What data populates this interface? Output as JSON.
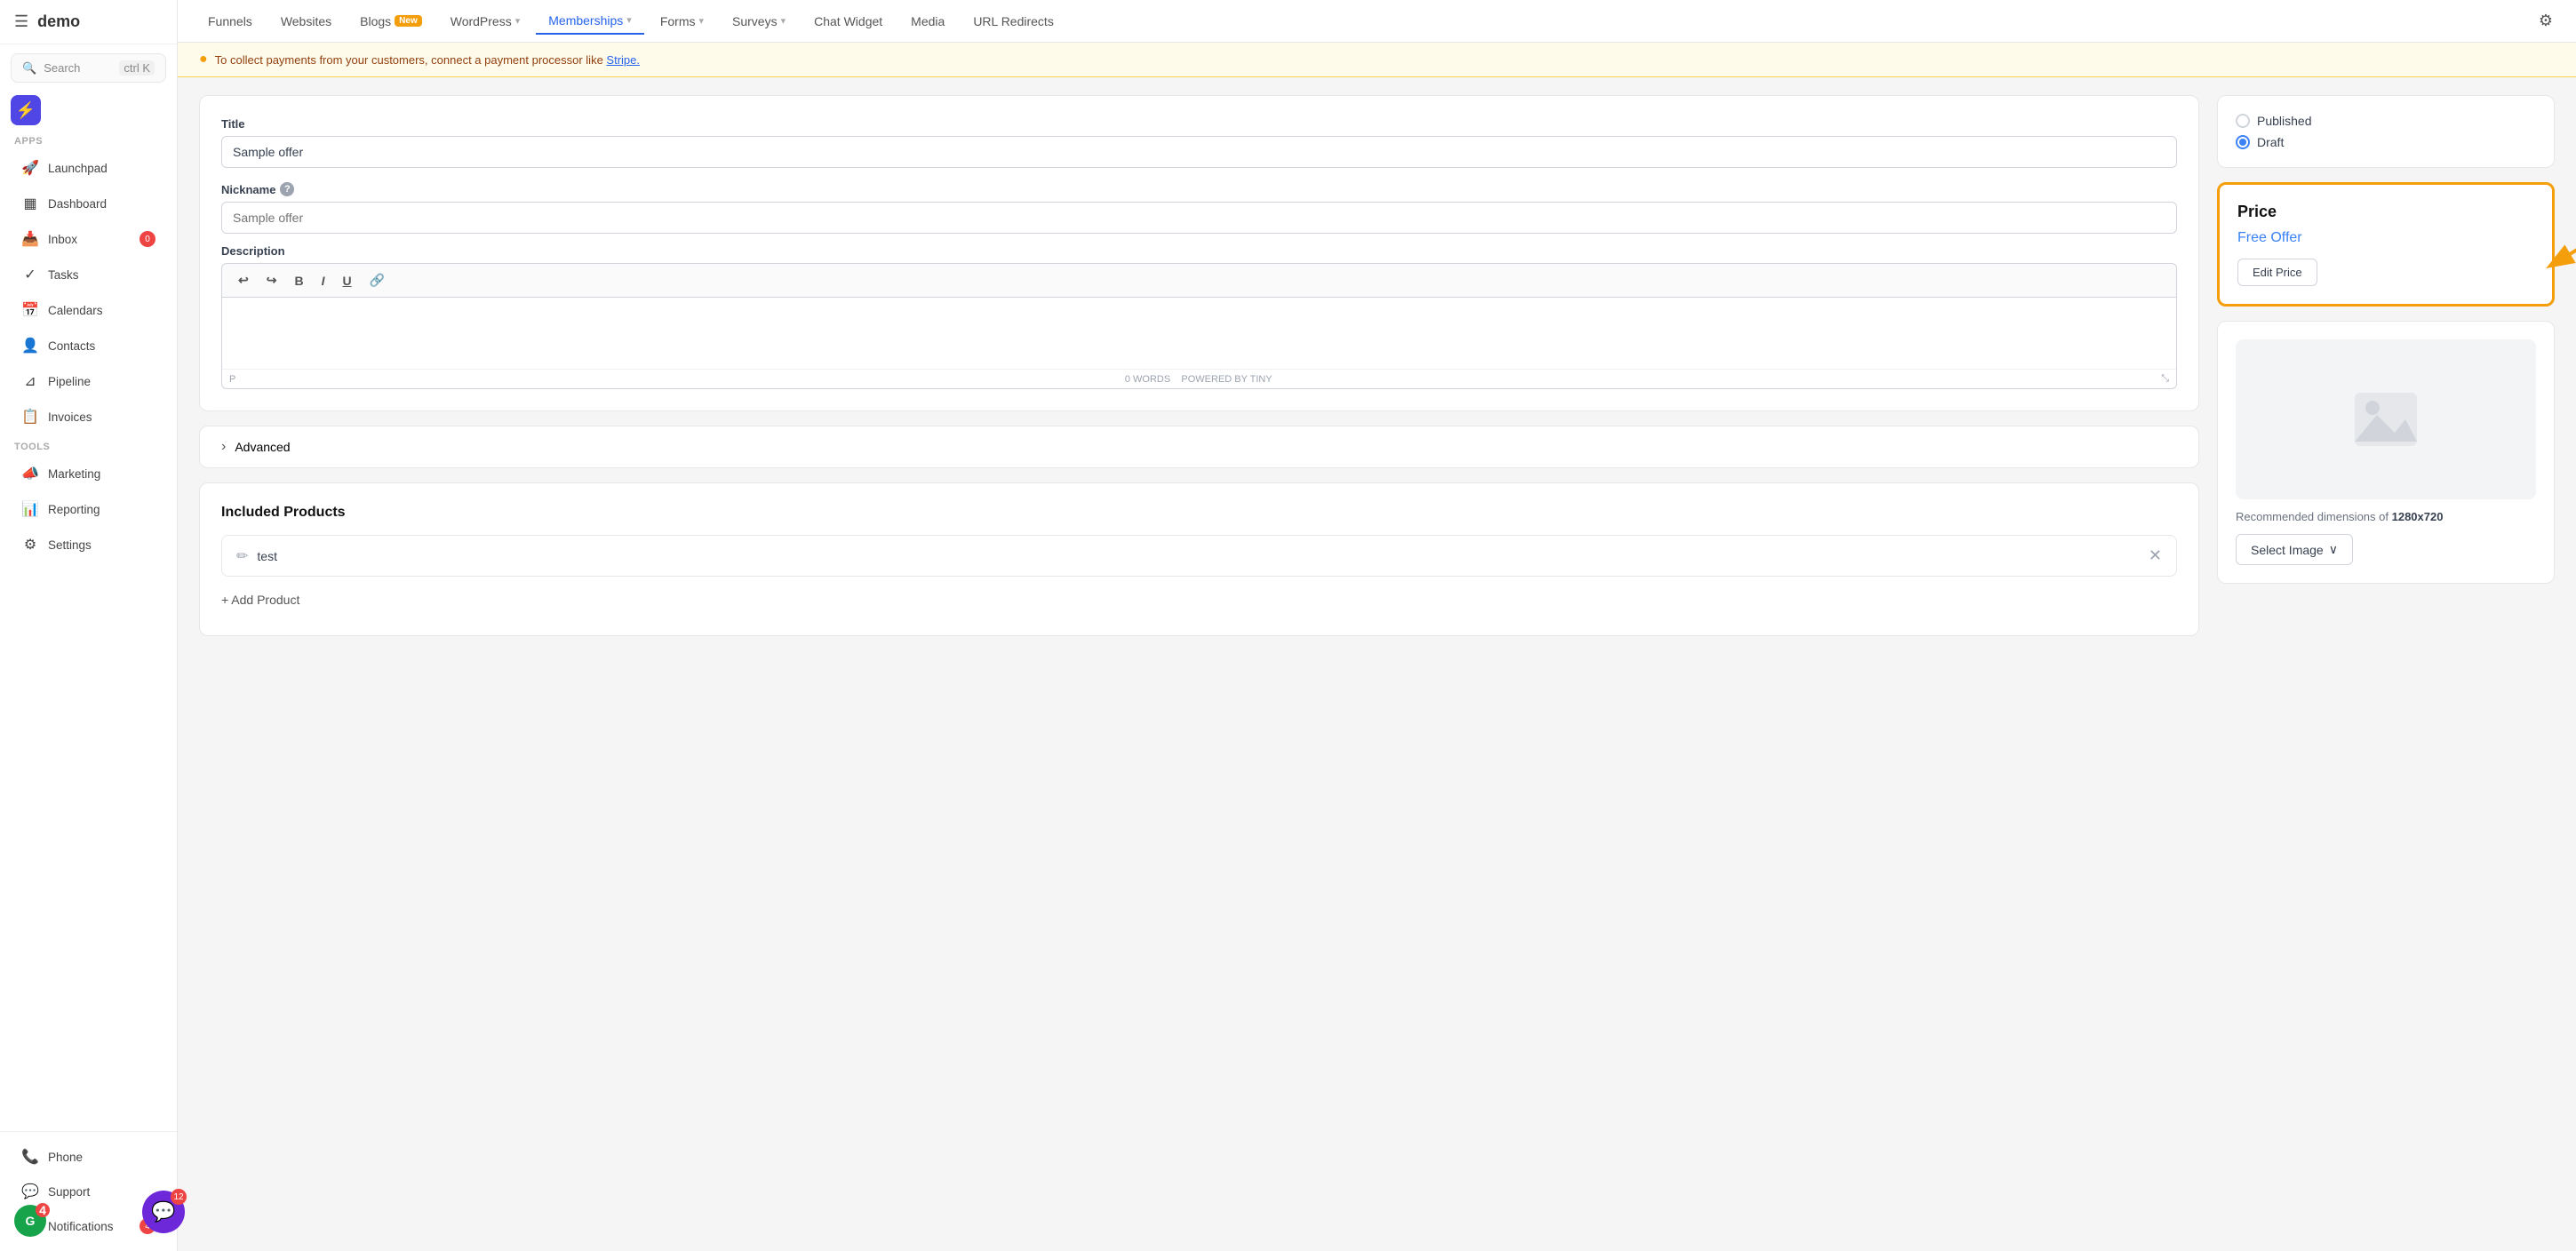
{
  "app": {
    "logo": "demo",
    "search_label": "Search",
    "search_shortcut": "ctrl K"
  },
  "sidebar": {
    "apps_label": "Apps",
    "tools_label": "Tools",
    "items": [
      {
        "id": "launchpad",
        "label": "Launchpad",
        "icon": "🚀",
        "badge": null
      },
      {
        "id": "dashboard",
        "label": "Dashboard",
        "icon": "▦",
        "badge": null
      },
      {
        "id": "inbox",
        "label": "Inbox",
        "icon": "📥",
        "badge": "0"
      },
      {
        "id": "tasks",
        "label": "Tasks",
        "icon": "✓",
        "badge": null
      },
      {
        "id": "calendars",
        "label": "Calendars",
        "icon": "📅",
        "badge": null
      },
      {
        "id": "contacts",
        "label": "Contacts",
        "icon": "👤",
        "badge": null
      },
      {
        "id": "pipeline",
        "label": "Pipeline",
        "icon": "⊿",
        "badge": null
      },
      {
        "id": "invoices",
        "label": "Invoices",
        "icon": "📋",
        "badge": null
      },
      {
        "id": "marketing",
        "label": "Marketing",
        "icon": "📣",
        "badge": null
      },
      {
        "id": "reporting",
        "label": "Reporting",
        "icon": "📊",
        "badge": null
      },
      {
        "id": "settings",
        "label": "Settings",
        "icon": "⚙",
        "badge": null
      }
    ],
    "bottom_items": [
      {
        "id": "phone",
        "label": "Phone",
        "icon": "📞"
      },
      {
        "id": "support",
        "label": "Support",
        "icon": "💬"
      },
      {
        "id": "notifications",
        "label": "Notifications",
        "icon": "🔔",
        "badge": "4"
      }
    ]
  },
  "top_nav": {
    "items": [
      {
        "id": "funnels",
        "label": "Funnels",
        "has_chevron": false,
        "new": false
      },
      {
        "id": "websites",
        "label": "Websites",
        "has_chevron": false,
        "new": false
      },
      {
        "id": "blogs",
        "label": "Blogs",
        "has_chevron": false,
        "new": true
      },
      {
        "id": "wordpress",
        "label": "WordPress",
        "has_chevron": true,
        "new": false
      },
      {
        "id": "memberships",
        "label": "Memberships",
        "has_chevron": true,
        "new": false,
        "active": true
      },
      {
        "id": "forms",
        "label": "Forms",
        "has_chevron": true,
        "new": false
      },
      {
        "id": "surveys",
        "label": "Surveys",
        "has_chevron": true,
        "new": false
      },
      {
        "id": "chat-widget",
        "label": "Chat Widget",
        "has_chevron": false,
        "new": false
      },
      {
        "id": "media",
        "label": "Media",
        "has_chevron": false,
        "new": false
      },
      {
        "id": "url-redirects",
        "label": "URL Redirects",
        "has_chevron": false,
        "new": false
      }
    ],
    "gear_icon_label": "settings"
  },
  "warning_banner": {
    "message": "To collect payments from your customers, connect a payment processor like Stripe.",
    "link_text": "Stripe."
  },
  "form": {
    "title_label": "Title",
    "title_value": "Sample offer",
    "nickname_label": "Nickname",
    "nickname_placeholder": "Sample offer",
    "description_label": "Description",
    "editor_undo": "↩",
    "editor_redo": "↪",
    "editor_bold": "B",
    "editor_italic": "I",
    "editor_underline": "U",
    "editor_link": "🔗",
    "editor_status": "P",
    "editor_word_count": "0 WORDS",
    "editor_powered": "POWERED BY TINY",
    "advanced_label": "Advanced",
    "products_title": "Included Products",
    "product_item": "test",
    "add_product_label": "+ Add Product"
  },
  "status_panel": {
    "published_label": "Published",
    "draft_label": "Draft",
    "selected": "draft"
  },
  "price_panel": {
    "title": "Price",
    "value": "Free Offer",
    "edit_button": "Edit Price"
  },
  "image_panel": {
    "rec_text": "Recommended dimensions of",
    "rec_dimensions": "1280x720",
    "select_label": "Select Image",
    "chevron": "∨"
  },
  "chat": {
    "bubble_count": "12",
    "notif_count": "4"
  }
}
